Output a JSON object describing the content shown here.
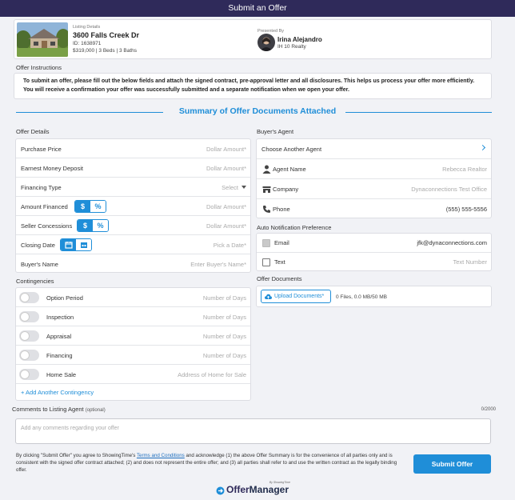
{
  "header": {
    "title": "Submit an Offer"
  },
  "listing": {
    "caption": "Listing Details",
    "address": "3600 Falls Creek Dr",
    "id": "ID: 1638971",
    "meta": "$319,000 | 3 Beds | 3 Baths",
    "presented_caption": "Presented By",
    "agent_name": "Irina Alejandro",
    "agent_company": "IH 10 Realty"
  },
  "instructions": {
    "title": "Offer Instructions",
    "text": "To submit an offer, please fill out the below fields and attach the signed contract, pre-approval letter and all disclosures. This helps us process your offer more efficiently. You will receive a confirmation your offer was successfully submitted and a separate notification when we open your offer."
  },
  "summary_title": "Summary of Offer Documents Attached",
  "offer_details": {
    "title": "Offer Details",
    "purchase_price": {
      "label": "Purchase Price",
      "placeholder": "Dollar Amount*"
    },
    "earnest_money": {
      "label": "Earnest Money Deposit",
      "placeholder": "Dollar Amount*"
    },
    "financing_type": {
      "label": "Financing Type",
      "value": "Select"
    },
    "amount_financed": {
      "label": "Amount Financed",
      "placeholder": "Dollar Amount*",
      "dollar": "$",
      "percent": "%"
    },
    "seller_concessions": {
      "label": "Seller Concessions",
      "placeholder": "Dollar Amount*",
      "dollar": "$",
      "percent": "%"
    },
    "closing_date": {
      "label": "Closing Date",
      "placeholder": "Pick a Date*"
    },
    "buyers_name": {
      "label": "Buyer's Name",
      "placeholder": "Enter Buyer's Name*"
    }
  },
  "contingencies": {
    "title": "Contingencies",
    "items": [
      {
        "label": "Option Period",
        "placeholder": "Number of Days"
      },
      {
        "label": "Inspection",
        "placeholder": "Number of Days"
      },
      {
        "label": "Appraisal",
        "placeholder": "Number of Days"
      },
      {
        "label": "Financing",
        "placeholder": "Number of Days"
      },
      {
        "label": "Home Sale",
        "placeholder": "Address of Home for Sale"
      }
    ],
    "add_label": "+ Add Another Contingency"
  },
  "buyers_agent": {
    "title": "Buyer's Agent",
    "choose_label": "Choose Another Agent",
    "agent_name": {
      "label": "Agent Name",
      "value": "Rebecca Realtor"
    },
    "company": {
      "label": "Company",
      "value": "Dynaconnections Test Office"
    },
    "phone": {
      "label": "Phone",
      "value": "(555) 555-5556"
    }
  },
  "notification": {
    "title": "Auto Notification Preference",
    "email": {
      "label": "Email",
      "value": "jfk@dynaconnections.com",
      "checked": true
    },
    "text": {
      "label": "Text",
      "placeholder": "Text Number",
      "checked": false
    }
  },
  "offer_documents": {
    "title": "Offer Documents",
    "upload_label": "Upload Documents*",
    "status": "0 Files, 0.0 MB/50 MB"
  },
  "comments": {
    "title": "Comments to Listing Agent",
    "optional": "(optional)",
    "counter": "0/2000",
    "placeholder": "Add any comments regarding your offer"
  },
  "disclaimer": {
    "before": "By clicking \"Submit Offer\" you agree to ShowingTime's ",
    "link": "Terms and Conditions",
    "after": " and acknowledge (1) the above Offer Summary is for the convenience of all parties only and is consistent with the signed offer contract attached; (2) and does not represent the entire offer; and (3) all parties shall refer to and use the written contract as the legally binding offer."
  },
  "submit_label": "Submit Offer",
  "footer": {
    "brand_small": "By ShowingTime",
    "brand_offer": "Offer",
    "brand_manager": "Manager"
  },
  "colors": {
    "accent": "#1f8ed8",
    "header_bg": "#2f2a5a",
    "page_bg": "#f1f2f6"
  }
}
